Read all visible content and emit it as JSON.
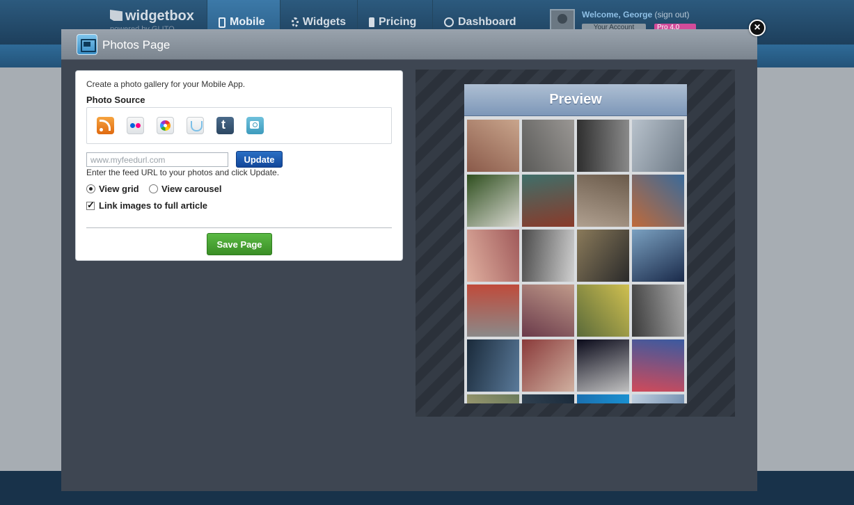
{
  "site": {
    "logo": "widgetbox",
    "logo_sub": "powered by GLITO",
    "nav": [
      "Mobile",
      "Widgets",
      "Pricing",
      "Dashboard"
    ],
    "welcome_label": "Welcome,",
    "user_name": "George",
    "sign_out": "(sign out)",
    "account_button": "Your Account",
    "pro_badge": "Pro 4.0"
  },
  "modal": {
    "title": "Photos Page",
    "close_label": "×"
  },
  "form": {
    "description": "Create a photo gallery for your Mobile App.",
    "source_label": "Photo Source",
    "sources": [
      "rss-icon",
      "flickr-icon",
      "picasa-icon",
      "smugmug-icon",
      "tumblr-icon",
      "instagram-icon"
    ],
    "url_placeholder": "www.myfeedurl.com",
    "url_value": "",
    "update_label": "Update",
    "hint": "Enter the feed URL to your photos and click Update.",
    "view_grid_label": "View grid",
    "view_carousel_label": "View carousel",
    "view_mode": "grid",
    "link_label": "Link images to full article",
    "link_checked": true,
    "save_label": "Save Page"
  },
  "preview": {
    "title": "Preview",
    "thumbnail_count": 24
  },
  "colors": {
    "accent_blue": "#12479a",
    "save_green": "#3a8e26",
    "modal_bg": "#3e4652"
  }
}
